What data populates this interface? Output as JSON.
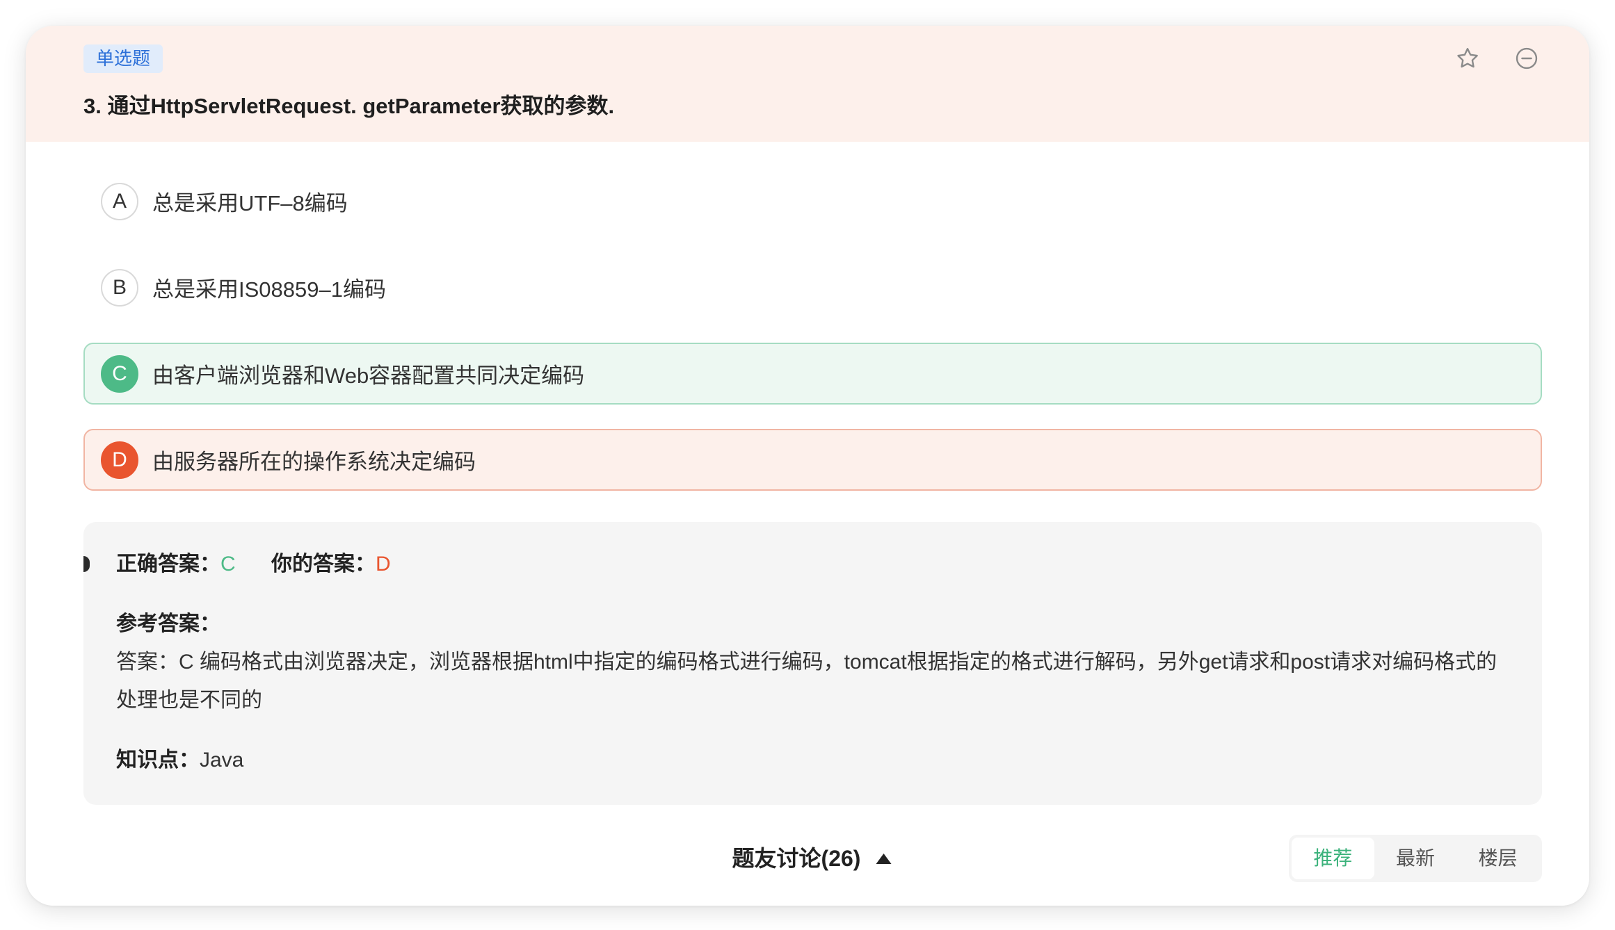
{
  "question": {
    "type_tag": "单选题",
    "title": "3. 通过HttpServletRequest. getParameter获取的参数."
  },
  "icons": {
    "favorite": "star-icon",
    "remove": "minus-circle-icon",
    "discussion_toggle": "caret-up-icon"
  },
  "options": [
    {
      "letter": "A",
      "text": "总是采用UTF–8编码"
    },
    {
      "letter": "B",
      "text": "总是采用IS08859–1编码"
    },
    {
      "letter": "C",
      "text": "由客户端浏览器和Web容器配置共同决定编码"
    },
    {
      "letter": "D",
      "text": "由服务器所在的操作系统决定编码"
    }
  ],
  "result": {
    "correct_label": "正确答案：",
    "correct_value": "C",
    "your_label": "你的答案：",
    "your_value": "D",
    "reference_label": "参考答案：",
    "reference_text": "答案：C 编码格式由浏览器决定，浏览器根据html中指定的编码格式进行编码，tomcat根据指定的格式进行解码，另外get请求和post请求对编码格式的处理也是不同的",
    "knowledge_label": "知识点：",
    "knowledge_value": "Java"
  },
  "discussion": {
    "label": "题友讨论(26)"
  },
  "sort_tabs": [
    {
      "label": "推荐"
    },
    {
      "label": "最新"
    },
    {
      "label": "楼层"
    }
  ],
  "colors": {
    "correct": "#4dba87",
    "wrong": "#e9552f",
    "header_bg": "#fdf0eb",
    "tag_text": "#2b6fd8",
    "tag_bg": "#e1ecfb",
    "active_tab": "#3bb27b"
  }
}
